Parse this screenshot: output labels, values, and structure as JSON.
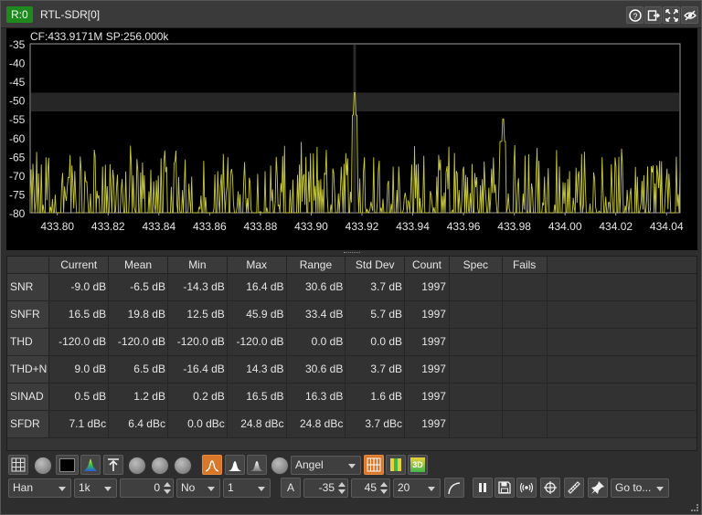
{
  "window": {
    "rx_badge": "R:0",
    "title": "RTL-SDR[0]",
    "buttons": [
      "help-icon",
      "move-to-workspace-icon",
      "maximize-icon",
      "hide-icon"
    ]
  },
  "plot": {
    "header": "CF:433.9171M SP:256.000k",
    "trace_color": "#c8c83c",
    "background": "#000000",
    "chart_data": {
      "type": "line",
      "xlabel": "",
      "ylabel": "",
      "xlim": [
        433.7893,
        434.0453
      ],
      "ylim": [
        -80,
        -35
      ],
      "x_ticks": [
        "433.80",
        "433.82",
        "433.84",
        "433.86",
        "433.88",
        "433.90",
        "433.92",
        "433.94",
        "433.96",
        "433.98",
        "434.00",
        "434.02",
        "434.04"
      ],
      "y_ticks": [
        "-35",
        "-40",
        "-45",
        "-50",
        "-55",
        "-60",
        "-65",
        "-70",
        "-75",
        "-80"
      ],
      "highlight_band_db": [
        -53,
        -48
      ],
      "center_marker_mhz": 433.9171,
      "peaks": [
        {
          "x": 433.9171,
          "y": -48
        },
        {
          "x": 433.9755,
          "y": -55
        }
      ],
      "noise_floor_db": -80,
      "noise_top_db": -60
    }
  },
  "table": {
    "columns": [
      "",
      "Current",
      "Mean",
      "Min",
      "Max",
      "Range",
      "Std Dev",
      "Count",
      "Spec",
      "Fails"
    ],
    "rows": [
      {
        "name": "SNR",
        "current": "-9.0 dB",
        "mean": "-6.5 dB",
        "min": "-14.3 dB",
        "max": "16.4 dB",
        "range": "30.6 dB",
        "std": "3.7 dB",
        "count": "1997",
        "spec": "",
        "fails": ""
      },
      {
        "name": "SNFR",
        "current": "16.5 dB",
        "mean": "19.8 dB",
        "min": "12.5 dB",
        "max": "45.9 dB",
        "range": "33.4 dB",
        "std": "5.7 dB",
        "count": "1997",
        "spec": "",
        "fails": ""
      },
      {
        "name": "THD",
        "current": "-120.0 dB",
        "mean": "-120.0 dB",
        "min": "-120.0 dB",
        "max": "-120.0 dB",
        "range": "0.0 dB",
        "std": "0.0 dB",
        "count": "1997",
        "spec": "",
        "fails": ""
      },
      {
        "name": "THD+N",
        "current": "9.0 dB",
        "mean": "6.5 dB",
        "min": "-16.4 dB",
        "max": "14.3 dB",
        "range": "30.6 dB",
        "std": "3.7 dB",
        "count": "1997",
        "spec": "",
        "fails": ""
      },
      {
        "name": "SINAD",
        "current": "0.5 dB",
        "mean": "1.2 dB",
        "min": "0.2 dB",
        "max": "16.5 dB",
        "range": "16.3 dB",
        "std": "1.6 dB",
        "count": "1997",
        "spec": "",
        "fails": ""
      },
      {
        "name": "SFDR",
        "current": "7.1 dBc",
        "mean": "6.4 dBc",
        "min": "0.0 dBc",
        "max": "24.8 dBc",
        "range": "24.8 dBc",
        "std": "3.7 dBc",
        "count": "1997",
        "spec": "",
        "fails": ""
      }
    ]
  },
  "controls": {
    "colormap": "Angel",
    "window": "Han",
    "fft_size": "1k",
    "offset": "0",
    "overlap": "No",
    "averaging": "1",
    "auto_label": "A",
    "ref_level": "-35",
    "range": "45",
    "range_step": "20",
    "goto": "Go to...",
    "label_3d": "3D"
  }
}
